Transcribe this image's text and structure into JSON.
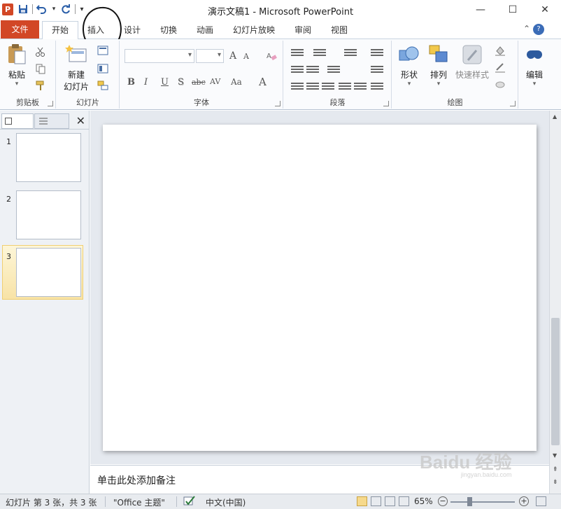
{
  "titlebar": {
    "app_icon": "P",
    "title": "演示文稿1 - Microsoft PowerPoint",
    "minimize": "—",
    "maximize": "☐",
    "close": "✕",
    "qat_icons": [
      "save-icon",
      "undo-icon",
      "redo-icon",
      "customize-icon"
    ]
  },
  "tabs": {
    "file": "文件",
    "items": [
      "开始",
      "插入",
      "设计",
      "切换",
      "动画",
      "幻灯片放映",
      "审阅",
      "视图"
    ]
  },
  "ribbon": {
    "clipboard": {
      "label": "剪贴板",
      "paste": "粘贴"
    },
    "slides": {
      "label": "幻灯片",
      "new_slide_line1": "新建",
      "new_slide_line2": "幻灯片"
    },
    "font": {
      "label": "字体",
      "bold": "B",
      "italic": "I",
      "underline": "U",
      "shadow": "S",
      "strike": "abc",
      "spacing": "AV",
      "case": "Aa",
      "grow": "A",
      "shrink": "A",
      "color": "A"
    },
    "paragraph": {
      "label": "段落"
    },
    "drawing": {
      "label": "绘图",
      "shapes": "形状",
      "arrange": "排列",
      "quick_styles": "快速样式"
    },
    "editing": {
      "label": "编辑"
    }
  },
  "outline_panel": {
    "close": "✕",
    "slides": [
      {
        "number": "1",
        "selected": false
      },
      {
        "number": "2",
        "selected": false
      },
      {
        "number": "3",
        "selected": true
      }
    ]
  },
  "notes": {
    "placeholder": "单击此处添加备注"
  },
  "statusbar": {
    "slide_info": "幻灯片 第 3 张，共 3 张",
    "theme": "\"Office 主题\"",
    "language": "中文(中国)",
    "zoom": "65%",
    "zoom_out": "−",
    "zoom_in": "+"
  },
  "watermark": {
    "text": "Baidu 经验",
    "sub": "jingyan.baidu.com"
  },
  "colors": {
    "accent": "#d24726",
    "ribbon_bg": "#fafbfd",
    "panel_bg": "#eef1f5",
    "workspace_bg": "#e5e9ef"
  }
}
